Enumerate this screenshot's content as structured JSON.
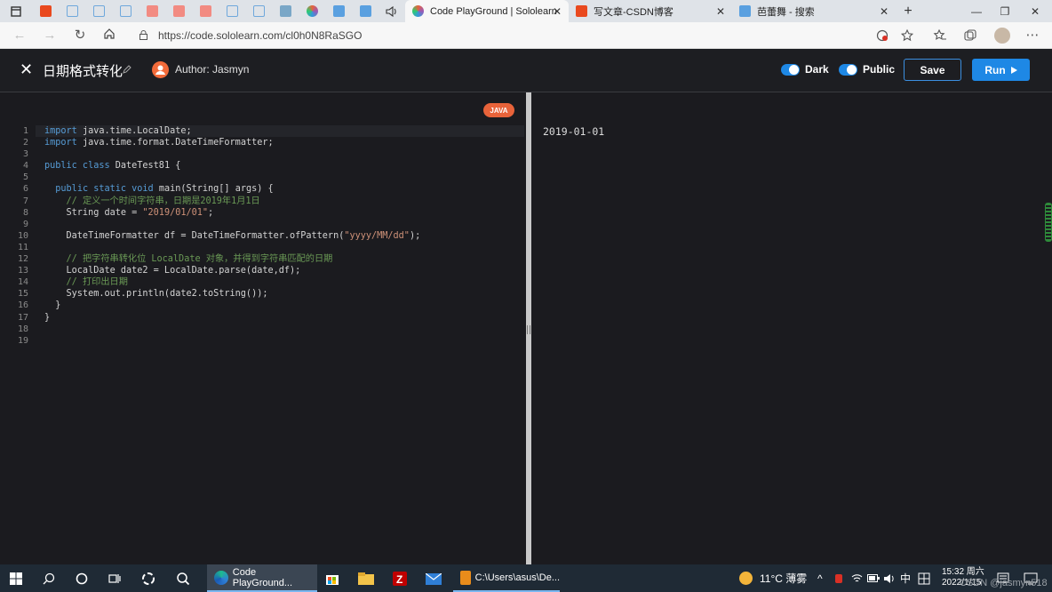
{
  "browser": {
    "active_tab_title": "Code PlayGround | Sololearn",
    "tab2_title": "写文章-CSDN博客",
    "tab3_title": "芭蕾舞 - 搜索",
    "url": "https://code.sololearn.com/cl0h0N8RaSGO"
  },
  "header": {
    "title": "日期格式转化",
    "author": "Author: Jasmyn",
    "dark_label": "Dark",
    "public_label": "Public",
    "save_label": "Save",
    "run_label": "Run"
  },
  "editor": {
    "language": "JAVA",
    "line_numbers": [
      "1",
      "2",
      "3",
      "4",
      "5",
      "6",
      "7",
      "8",
      "9",
      "10",
      "11",
      "12",
      "13",
      "14",
      "15",
      "16",
      "17",
      "18",
      "19"
    ]
  },
  "output": {
    "text": "2019-01-01"
  },
  "taskbar": {
    "browser_item": "Code PlayGround...",
    "cmd_item": "C:\\Users\\asus\\De...",
    "weather": "11°C 薄雾",
    "ime": "中",
    "time": "15:32 周六",
    "date": "2022/1/15"
  },
  "watermark": "CSDN @jasmyn518",
  "colors": {
    "accent": "#1e88e5",
    "badge": "#e8633a",
    "editor_bg": "#1b1b1f",
    "keyword": "#569cd6",
    "comment": "#6a9955",
    "string": "#ce9178"
  }
}
